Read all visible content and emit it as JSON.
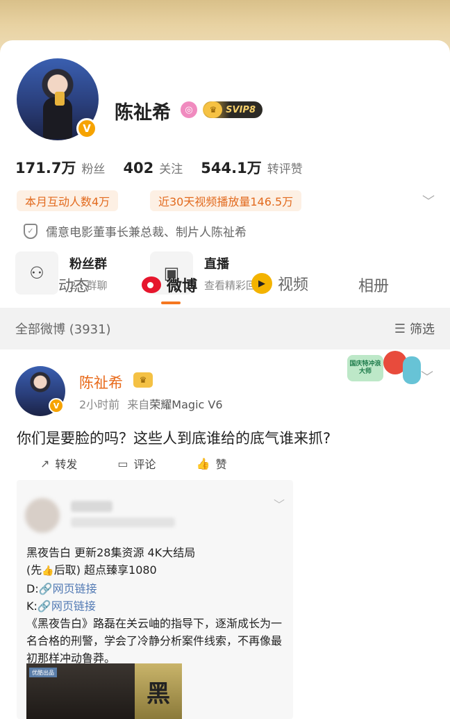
{
  "profile": {
    "name": "陈祉希",
    "badge_svip": "SVIP8",
    "stats": [
      {
        "value": "171.7万",
        "label": "粉丝"
      },
      {
        "value": "402",
        "label": "关注"
      },
      {
        "value": "544.1万",
        "label": "转评赞"
      }
    ],
    "pills": [
      "本月互动人数4万",
      "近30天视频播放量146.5万"
    ],
    "verification": "儒意电影董事长兼总裁、制片人陈祉希",
    "features": [
      {
        "title": "粉丝群",
        "subtitle": "2个群聊",
        "icon": "fans-group-icon"
      },
      {
        "title": "直播",
        "subtitle": "查看精彩回放",
        "icon": "tv-icon"
      }
    ]
  },
  "tabs": [
    {
      "label": "动态"
    },
    {
      "label": "微博",
      "active": true
    },
    {
      "label": "视频"
    },
    {
      "label": "相册"
    }
  ],
  "filter_bar": {
    "all_label": "全部微博 (3931)",
    "filter_label": "筛选"
  },
  "post": {
    "author": "陈祉希",
    "time": "2小时前",
    "source_prefix": "来自",
    "source": "荣耀Magic V6",
    "sticker_text": "国庆特冲浪大师",
    "text": "你们是要脸的吗？这些人到底谁给的底气谁来抓?",
    "actions": [
      "转发",
      "评论",
      "赞"
    ],
    "repost": {
      "line1": "黑夜告白  更新28集资源 4K大结局",
      "line2_a": "(先",
      "line2_b": "后取) 超点臻享1080",
      "line3_prefix": "D:",
      "line3_link": "网页链接",
      "line4_prefix": "K:",
      "line4_link": "网页链接",
      "body": "《黑夜告白》路磊在关云岫的指导下，逐渐成长为一名合格的刑警，学会了冷静分析案件线索，不再像最初那样冲动鲁莽。",
      "image_tag": "优酷出品",
      "image_char": "黑"
    }
  },
  "colors": {
    "accent_orange": "#f5771f",
    "name_orange": "#e86a1a",
    "link_blue": "#5078b3",
    "pill_bg": "#fdf0e4"
  }
}
